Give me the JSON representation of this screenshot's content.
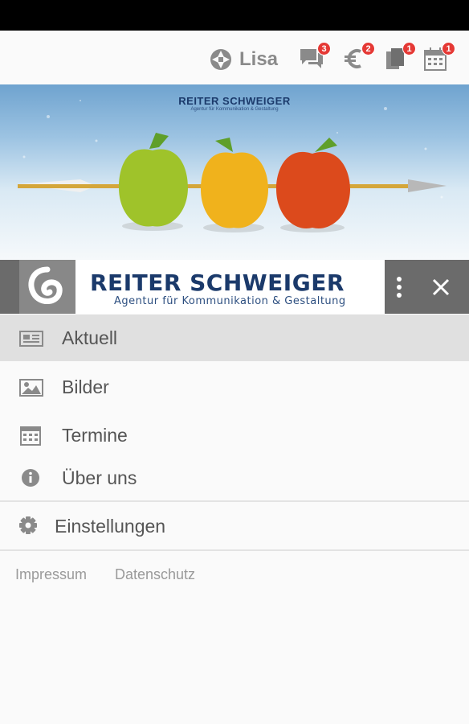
{
  "user": {
    "name": "Lisa",
    "icon": "user-logo-icon"
  },
  "top_icons": [
    {
      "name": "chat-icon",
      "badge": "3"
    },
    {
      "name": "euro-icon",
      "badge": "2"
    },
    {
      "name": "documents-icon",
      "badge": "1"
    },
    {
      "name": "calendar-icon",
      "badge": "1"
    }
  ],
  "banner": {
    "logo_title": "REITER SCHWEIGER",
    "logo_subtitle": "Agentur für Kommunikation & Gestaltung"
  },
  "nav_header": {
    "logo_title": "REITER SCHWEIGER",
    "logo_subtitle": "Agentur für Kommunikation & Gestaltung"
  },
  "menu": [
    {
      "label": "Aktuell",
      "icon": "newspaper-icon",
      "active": true
    },
    {
      "label": "Bilder",
      "icon": "image-icon",
      "active": false
    },
    {
      "label": "Termine",
      "icon": "calendar-icon",
      "active": false
    },
    {
      "label": "Über uns",
      "icon": "info-icon",
      "active": false
    }
  ],
  "settings": {
    "label": "Einstellungen",
    "icon": "gear-icon"
  },
  "footer": {
    "impressum": "Impressum",
    "datenschutz": "Datenschutz"
  },
  "colors": {
    "badge": "#e53935",
    "header": "#6b6b6b",
    "active_row": "#e0e0e0",
    "brand": "#1b3a6b"
  }
}
